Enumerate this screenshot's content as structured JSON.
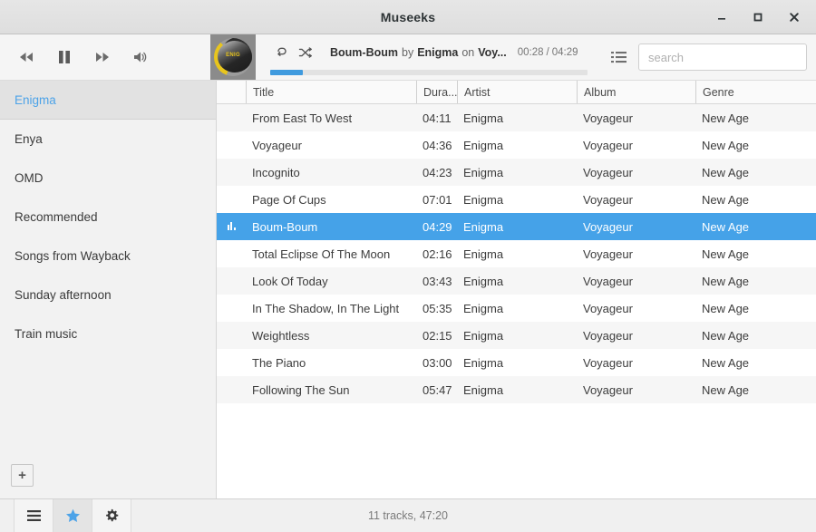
{
  "window": {
    "title": "Museeks",
    "minimize_label": "minimize-icon",
    "maximize_label": "maximize-icon",
    "close_label": "close-icon"
  },
  "player": {
    "previous_label": "previous-icon",
    "playpause_label": "pause-icon",
    "next_label": "next-icon",
    "volume_label": "volume-icon",
    "repeat_label": "repeat-icon",
    "shuffle_label": "shuffle-icon",
    "cover_caption": "ENIG",
    "now_playing": {
      "track": "Boum-Boum",
      "by_word": "by",
      "artist": "Enigma",
      "on_word": "on",
      "album": "Voy...",
      "elapsed": "00:28",
      "separator": "/",
      "total": "04:29",
      "progress_percent": 10.4
    },
    "queue_label": "queue-icon"
  },
  "search": {
    "value": "",
    "placeholder": "search"
  },
  "sidebar": {
    "items": [
      {
        "label": "Enigma",
        "active": true
      },
      {
        "label": "Enya",
        "active": false
      },
      {
        "label": "OMD",
        "active": false
      },
      {
        "label": "Recommended",
        "active": false
      },
      {
        "label": "Songs from Wayback",
        "active": false
      },
      {
        "label": "Sunday afternoon",
        "active": false
      },
      {
        "label": "Train music",
        "active": false
      }
    ],
    "add_label": "+"
  },
  "table": {
    "columns": [
      "Title",
      "Dura...",
      "Artist",
      "Album",
      "Genre"
    ],
    "rows": [
      {
        "title": "From East To West",
        "duration": "04:11",
        "artist": "Enigma",
        "album": "Voyageur",
        "genre": "New Age",
        "playing": false
      },
      {
        "title": "Voyageur",
        "duration": "04:36",
        "artist": "Enigma",
        "album": "Voyageur",
        "genre": "New Age",
        "playing": false
      },
      {
        "title": "Incognito",
        "duration": "04:23",
        "artist": "Enigma",
        "album": "Voyageur",
        "genre": "New Age",
        "playing": false
      },
      {
        "title": "Page Of Cups",
        "duration": "07:01",
        "artist": "Enigma",
        "album": "Voyageur",
        "genre": "New Age",
        "playing": false
      },
      {
        "title": "Boum-Boum",
        "duration": "04:29",
        "artist": "Enigma",
        "album": "Voyageur",
        "genre": "New Age",
        "playing": true
      },
      {
        "title": "Total Eclipse Of The Moon",
        "duration": "02:16",
        "artist": "Enigma",
        "album": "Voyageur",
        "genre": "New Age",
        "playing": false
      },
      {
        "title": "Look Of Today",
        "duration": "03:43",
        "artist": "Enigma",
        "album": "Voyageur",
        "genre": "New Age",
        "playing": false
      },
      {
        "title": "In The Shadow, In The Light",
        "duration": "05:35",
        "artist": "Enigma",
        "album": "Voyageur",
        "genre": "New Age",
        "playing": false
      },
      {
        "title": "Weightless",
        "duration": "02:15",
        "artist": "Enigma",
        "album": "Voyageur",
        "genre": "New Age",
        "playing": false
      },
      {
        "title": "The Piano",
        "duration": "03:00",
        "artist": "Enigma",
        "album": "Voyageur",
        "genre": "New Age",
        "playing": false
      },
      {
        "title": "Following The Sun",
        "duration": "05:47",
        "artist": "Enigma",
        "album": "Voyageur",
        "genre": "New Age",
        "playing": false
      }
    ]
  },
  "statusbar": {
    "tabs": [
      {
        "icon": "library-icon",
        "active": false
      },
      {
        "icon": "star-icon",
        "active": true
      },
      {
        "icon": "settings-icon",
        "active": false
      }
    ],
    "status": "11 tracks, 47:20"
  },
  "colors": {
    "accent": "#45a2e8",
    "accent_text": "#4da3e8",
    "progress": "#3f9ade",
    "row_alt": "#f6f6f6",
    "sidebar_bg": "#f2f2f2"
  }
}
